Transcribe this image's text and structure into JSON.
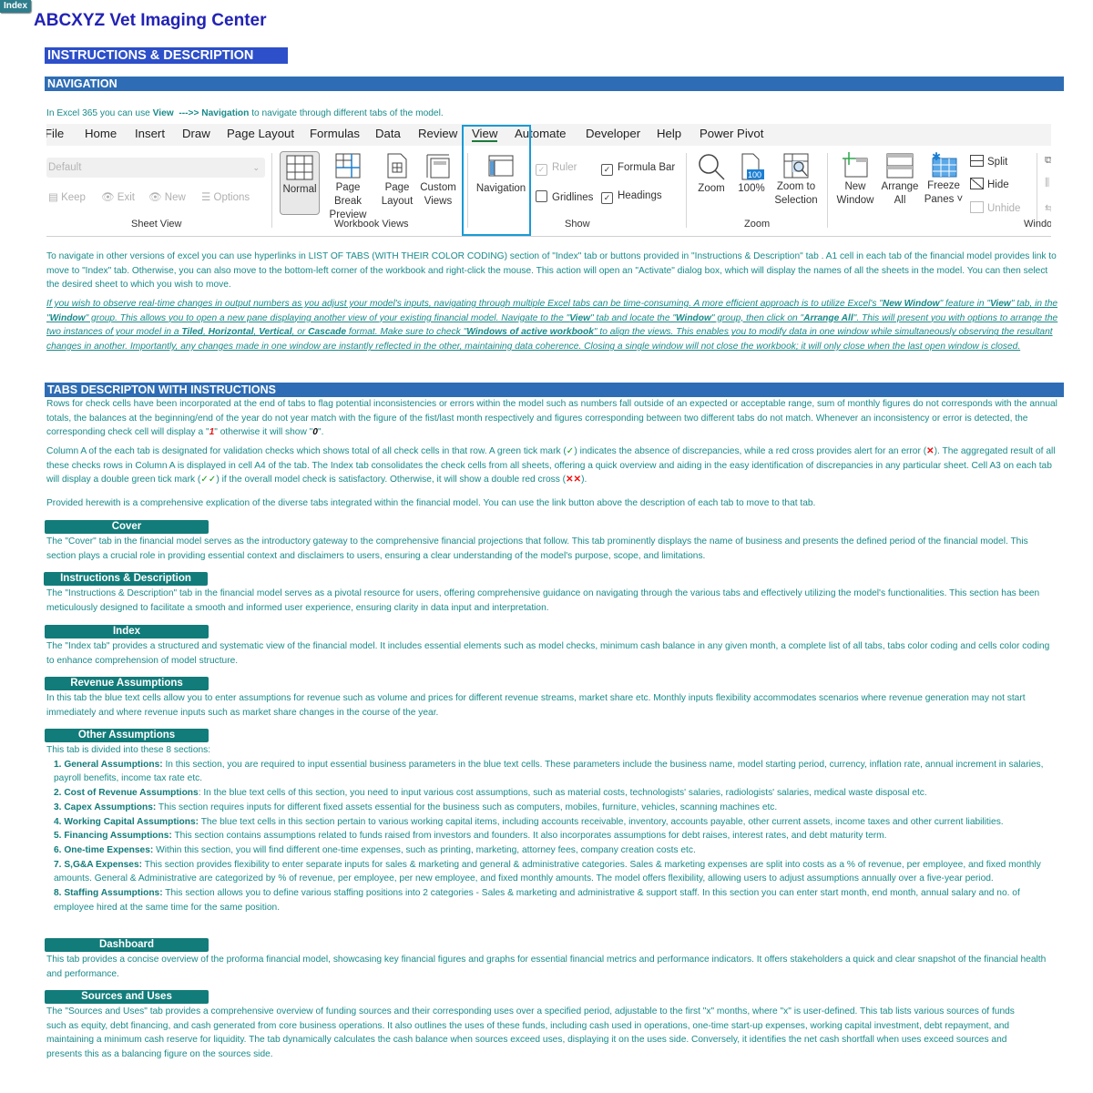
{
  "index_button": "Index",
  "company_name": "ABCXYZ Vet Imaging Center",
  "page_banner": "INSTRUCTIONS & DESCRIPTION",
  "navigation": {
    "banner": "NAVIGATION",
    "intro": {
      "pre": "In Excel 365 you can use ",
      "view": "View",
      "arrow": "  --->> ",
      "nav": "Navigation",
      "post": " to navigate through different tabs of the model."
    },
    "para1": "To navigate in other versions of excel you can use hyperlinks in LIST OF TABS (WITH THEIR COLOR CODING) section of \"Index\" tab or buttons provided in  \"Instructions & Description\" tab . A1 cell in each tab of the financial model provides link to move to \"Index\" tab. Otherwise, you can also move to the bottom-left corner of the workbook and right-click the mouse. This action will open an \"Activate\" dialog box, which will display the names of all the sheets in the model. You can then select the desired sheet to which you wish to move.",
    "para2": {
      "t1": "If you wish to observe real-time changes in output numbers as you adjust your model's inputs, navigating through multiple Excel tabs can be time-consuming. A more efficient approach is to utilize Excel's \"",
      "b1": "New Window",
      "t2": "\" feature in \"",
      "b2": "View",
      "t3": "\" tab, in the \"",
      "b3": "Window",
      "t4": "\" group. This allows you to open a new pane displaying another view of your existing financial model. Navigate to the \"",
      "b4": "View",
      "t5": "\" tab and locate the \"",
      "b5": "Window",
      "t6": "\" group, then click on \"",
      "b6": "Arrange All",
      "t7": "\". This will present you with options to arrange the two instances of your model in a ",
      "b7": "Tiled",
      "t8": ", ",
      "b8": "Horizontal",
      "t9": ", ",
      "b9": "Vertical",
      "t10": ", or ",
      "b10": "Cascade",
      "t11": " format. Make sure to check \"",
      "b11": "Windows of active workbook",
      "t12": "\" to align the views. This  enables you to modify data in one window while simultaneously observing the resultant changes in another. Importantly, any changes made in one window are instantly reflected in the other, maintaining data coherence. Closing a single window will not close the workbook; it will only close when the last open window is closed."
    }
  },
  "ribbon": {
    "tabs": [
      "File",
      "Home",
      "Insert",
      "Draw",
      "Page Layout",
      "Formulas",
      "Data",
      "Review",
      "View",
      "Automate",
      "Developer",
      "Help",
      "Power Pivot"
    ],
    "active_tab": "View",
    "sheet_view": {
      "select_value": "Default",
      "keep": "Keep",
      "exit": "Exit",
      "new": "New",
      "options": "Options",
      "label": "Sheet View"
    },
    "workbook_views": {
      "normal": "Normal",
      "page_break_preview": [
        "Page Break",
        "Preview"
      ],
      "page_layout": [
        "Page",
        "Layout"
      ],
      "custom_views": [
        "Custom",
        "Views"
      ],
      "label": "Workbook Views"
    },
    "navigation_btn": "Navigation",
    "show": {
      "ruler": "Ruler",
      "ruler_checked": true,
      "formula_bar": "Formula Bar",
      "formula_bar_checked": true,
      "gridlines": "Gridlines",
      "gridlines_checked": false,
      "headings": "Headings",
      "headings_checked": true,
      "label": "Show"
    },
    "zoom": {
      "zoom": "Zoom",
      "hundred": "100%",
      "hundred_icon_text": "100",
      "zoom_to_selection": [
        "Zoom to",
        "Selection"
      ],
      "label": "Zoom"
    },
    "window": {
      "new_window": [
        "New",
        "Window"
      ],
      "arrange_all": [
        "Arrange",
        "All"
      ],
      "freeze_panes": [
        "Freeze",
        "Panes ˅"
      ],
      "split": "Split",
      "hide": "Hide",
      "unhide": "Unhide",
      "label": "Windo"
    }
  },
  "tabs_section": {
    "banner": "TABS DESCRIPTON WITH INSTRUCTIONS",
    "para1": {
      "t1": "Rows for check cells have been incorporated at the end of tabs to flag potential inconsistencies or errors within the model such as numbers fall outside of an expected or acceptable range, sum of monthly figures do not corresponds with the annual totals, the balances at the beginning/end of the year do not year match with the figure of the fist/last month respectively and figures corresponding between two different tabs do not match. Whenever an inconsistency or error is detected, the corresponding check cell will display a \"",
      "one": "1",
      "t2": "\" otherwise it will show \"",
      "zero": "0",
      "t3": "\"."
    },
    "para2": {
      "t1": "Column A of the each tab is designated for validation checks which shows total of all check cells in that row. A green tick mark (",
      "tick": "✓",
      "t2": ") indicates the absence of discrepancies, while a red cross provides alert for an error (",
      "cross": "✕",
      "t3": "). The aggregated result of all these checks rows in Column A is displayed in cell A4 of the tab. The Index tab consolidates the check cells from all sheets, offering a quick overview and aiding in the easy identification of discrepancies in any particular sheet. Cell A3 on each tab will display a double green tick mark (",
      "dtick": "✓✓",
      "t4": ") if the overall model check is satisfactory. Otherwise, it will show a double red cross (",
      "dcross": "✕✕",
      "t5": ")."
    },
    "para3": "Provided herewith is a comprehensive explication of the diverse tabs integrated within the financial model. You can use the link button above the description of each tab to move to that tab.",
    "tabs": [
      {
        "label": "Cover",
        "desc": "The \"Cover\" tab in the financial model serves as the introductory gateway to the comprehensive financial projections that follow. This tab prominently displays the name of business and presents the defined period of the financial model. This section plays  a crucial role in providing essential context and disclaimers to users, ensuring a clear understanding of the model's purpose, scope, and limitations."
      },
      {
        "label": "Instructions & Description",
        "desc": "The \"Instructions & Description\" tab in the financial model serves as a pivotal resource for users, offering comprehensive guidance on navigating through the various tabs and effectively utilizing the model's functionalities. This section has been meticulously designed to facilitate a smooth and informed user experience, ensuring clarity in data input and interpretation."
      },
      {
        "label": "Index",
        "desc": "The \"Index tab\" provides a structured and systematic view of the financial model. It includes essential elements such as model checks, minimum cash balance in any given month, a complete list of all tabs, tabs color coding and cells color coding to enhance comprehension of model structure."
      },
      {
        "label": "Revenue Assumptions",
        "desc": "In this tab the blue text cells allow you to enter assumptions for revenue such as volume and prices for different revenue streams, market share etc. Monthly inputs flexibility accommodates scenarios where revenue generation may not start immediately and where revenue inputs such as market share changes in the course of the year."
      },
      {
        "label": "Other Assumptions",
        "desc": "This tab is divided into these 8 sections:"
      },
      {
        "label": "Dashboard",
        "desc": "This tab provides a concise overview of the proforma financial model, showcasing key financial figures and graphs for essential financial metrics and performance indicators. It offers stakeholders a quick and clear snapshot of the financial health and performance."
      },
      {
        "label": "Sources and Uses",
        "desc": "The \"Sources and Uses\" tab provides a comprehensive overview of funding sources and their corresponding uses over a specified period, adjustable to the first \"x\" months, where \"x\" is user-defined. This tab lists various sources of funds such as equity, debt financing, and cash generated from core business operations. It also outlines the uses of these funds, including cash used in operations, one-time start-up expenses, working capital investment, debt repayment, and maintaining  a minimum cash reserve for liquidity. The tab dynamically calculates the cash balance when sources exceed uses, displaying it on the uses side. Conversely, it identifies the net cash shortfall when uses exceed sources and presents this as a balancing figure on the sources side."
      }
    ],
    "other_sections": [
      {
        "title": "1. General Assumptions:",
        "text": " In this section, you are required to input essential business parameters in the blue text cells. These parameters include the business name, model starting period, currency, inflation rate, annual increment in salaries, payroll benefits, income tax rate etc."
      },
      {
        "title": "2. Cost of Revenue Assumptions",
        "text": ": In the blue text cells of this section, you need to input various cost assumptions, such as material costs, technologists' salaries, radiologists' salaries, medical waste disposal etc."
      },
      {
        "title": "3. Capex Assumptions:",
        "text": " This section requires inputs for different fixed assets essential for the business such as computers, mobiles, furniture, vehicles, scanning machines etc."
      },
      {
        "title": "4. Working Capital Assumptions:",
        "text": " The blue text cells in this section pertain to various working capital items, including accounts receivable, inventory, accounts payable, other current assets, income taxes and other current liabilities."
      },
      {
        "title": "5. Financing Assumptions:",
        "text": " This section contains assumptions related to funds raised from investors and founders. It also incorporates assumptions for debt raises, interest rates, and debt maturity term."
      },
      {
        "title": "6. One-time Expenses:",
        "text": " Within this section, you will find different one-time expenses, such as printing, marketing, attorney fees, company creation costs etc."
      },
      {
        "title": "7. S,G&A Expenses:",
        "text": " This section provides flexibility to enter separate inputs for sales & marketing and general & administrative categories. Sales & marketing expenses are split into costs as a % of revenue, per employee, and fixed monthly amounts. General & Administrative are categorized by % of revenue, per employee, per new employee, and fixed monthly amounts. The model offers flexibility, allowing users to adjust assumptions annually  over a  five-year period."
      },
      {
        "title": "8. Staffing Assumptions:",
        "text": " This section allows you to define various staffing positions into 2 categories - Sales & marketing and administrative & support staff. In this section you can enter start month, end month, annual salary and no. of employee hired at  the same time for the same position."
      }
    ]
  }
}
